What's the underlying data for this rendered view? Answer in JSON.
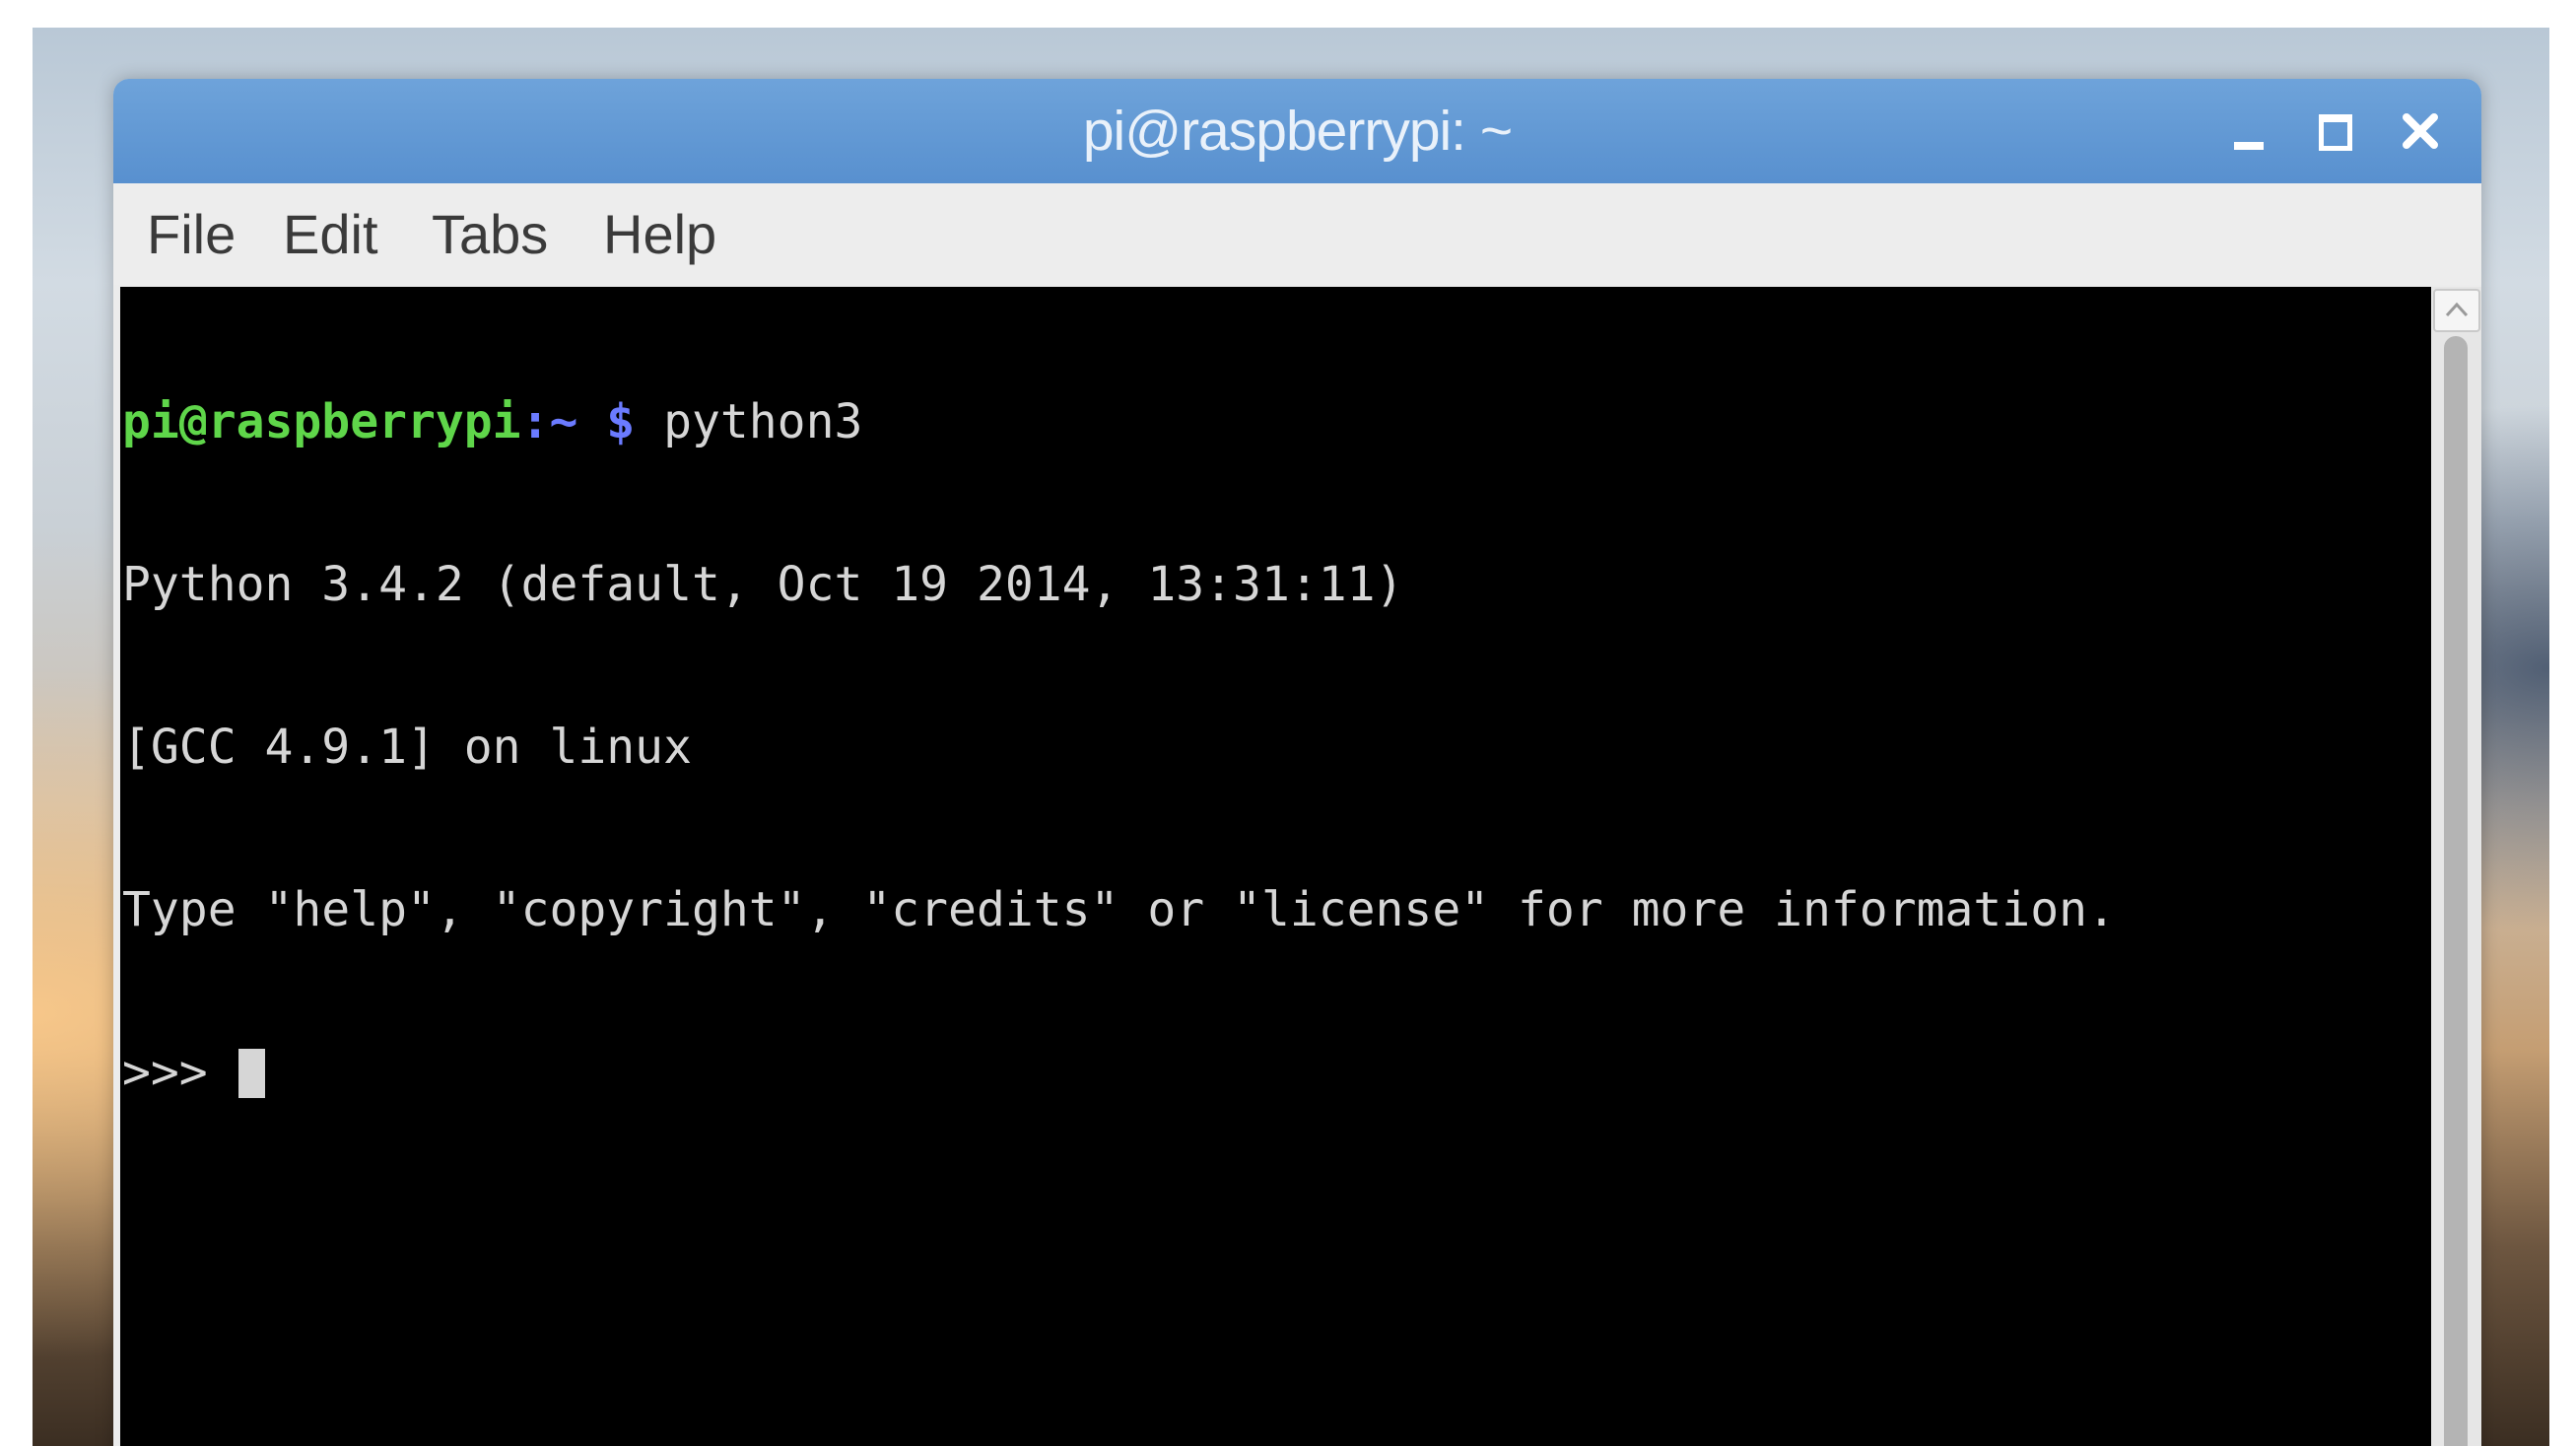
{
  "window": {
    "title": "pi@raspberrypi: ~",
    "controls": {
      "minimize": "minimize-icon",
      "maximize": "maximize-icon",
      "close": "close-icon"
    }
  },
  "menu": {
    "items": [
      "File",
      "Edit",
      "Tabs",
      "Help"
    ]
  },
  "terminal": {
    "prompt_user_host": "pi@raspberrypi",
    "prompt_path": ":~ $",
    "command": " python3",
    "output": [
      "Python 3.4.2 (default, Oct 19 2014, 13:31:11)",
      "[GCC 4.9.1] on linux",
      "Type \"help\", \"copyright\", \"credits\" or \"license\" for more information."
    ],
    "repl_prompt": ">>> "
  },
  "colors": {
    "titlebar": "#5e97d3",
    "prompt_user": "#5fd64a",
    "prompt_path": "#6b7bff",
    "terminal_bg": "#000000",
    "terminal_fg": "#d6d6d6"
  }
}
